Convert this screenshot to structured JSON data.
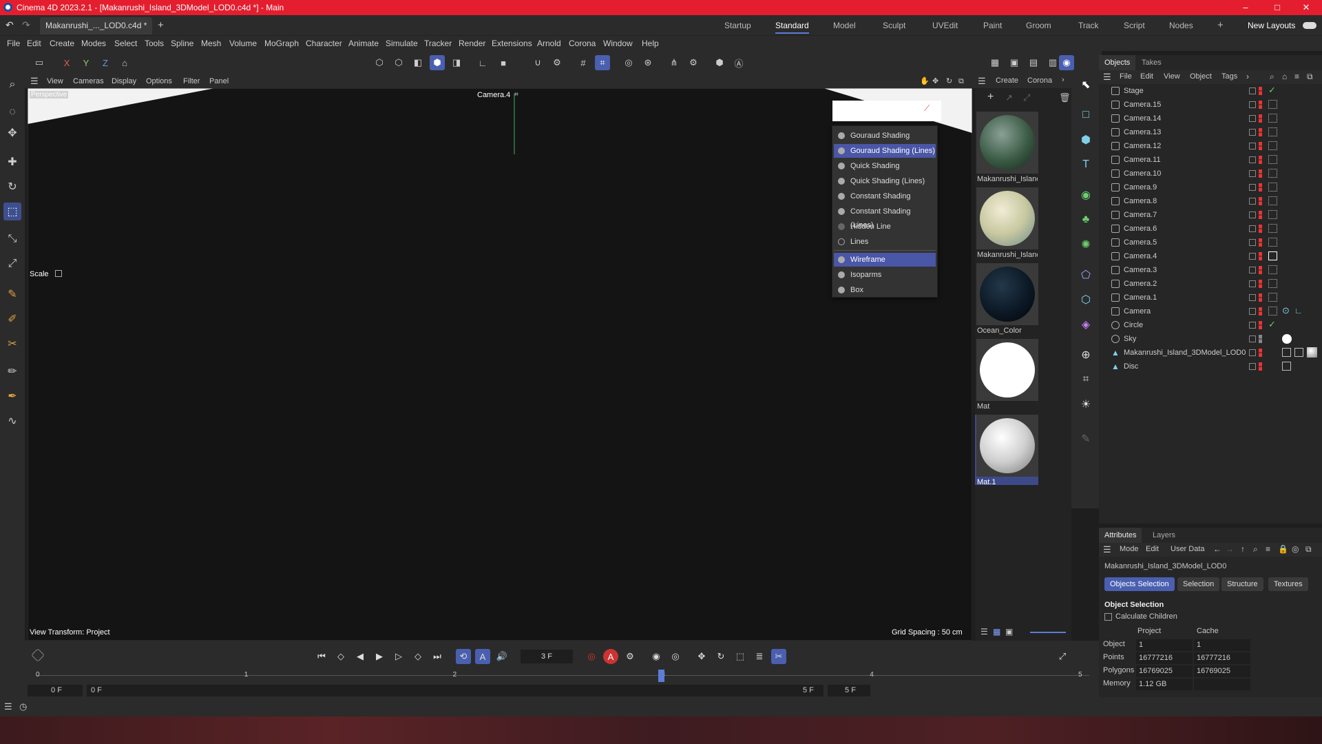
{
  "window": {
    "title": "Cinema 4D 2023.2.1 - [Makanrushi_Island_3DModel_LOD0.c4d *] - Main",
    "minimize": "–",
    "maximize": "□",
    "close": "✕"
  },
  "tabs": {
    "doc_tab": "Makanrushi_..._LOD0.c4d *",
    "add": "+",
    "layouts": [
      "Startup",
      "Standard",
      "Model",
      "Sculpt",
      "UVEdit",
      "Paint",
      "Groom",
      "Track",
      "Script",
      "Nodes"
    ],
    "active_layout": "Standard",
    "new_layouts": "New Layouts",
    "add_layout": "+"
  },
  "menu": [
    "File",
    "Edit",
    "Create",
    "Modes",
    "Select",
    "Tools",
    "Spline",
    "Mesh",
    "Volume",
    "MoGraph",
    "Character",
    "Animate",
    "Simulate",
    "Tracker",
    "Render",
    "Extensions",
    "Arnold",
    "Corona",
    "Window",
    "Help"
  ],
  "toolbar": {
    "axis_x": "X",
    "axis_y": "Y",
    "axis_z": "Z"
  },
  "viewport": {
    "menu": [
      "View",
      "Cameras",
      "Display",
      "Options",
      "Filter",
      "Panel"
    ],
    "label": "Perspective",
    "camera": "Camera.4",
    "tool_label": "Scale",
    "view_transform": "View Transform: Project",
    "grid_spacing": "Grid Spacing : 50 cm"
  },
  "display_menu": {
    "items": [
      "Gouraud Shading",
      "Gouraud Shading (Lines)",
      "Quick Shading",
      "Quick Shading (Lines)",
      "Constant Shading",
      "Constant Shading (Lines)",
      "Hidden Line",
      "Lines",
      "Wireframe",
      "Isoparms",
      "Box"
    ],
    "selected": [
      "Gouraud Shading (Lines)",
      "Wireframe"
    ]
  },
  "materials": {
    "menu": [
      "Create",
      "Corona"
    ],
    "items": [
      "Makanrushi_Islanc",
      "Makanrushi_Islanc",
      "Ocean_Color",
      "Mat",
      "Mat.1"
    ],
    "selected": "Mat.1"
  },
  "objects": {
    "tabs": [
      "Objects",
      "Takes"
    ],
    "menu": [
      "File",
      "Edit",
      "View",
      "Object",
      "Tags"
    ],
    "items": [
      "Stage",
      "Camera.15",
      "Camera.14",
      "Camera.13",
      "Camera.12",
      "Camera.11",
      "Camera.10",
      "Camera.9",
      "Camera.8",
      "Camera.7",
      "Camera.6",
      "Camera.5",
      "Camera.4",
      "Camera.3",
      "Camera.2",
      "Camera.1",
      "Camera",
      "Circle",
      "Sky",
      "Makanrushi_Island_3DModel_LOD0",
      "Disc"
    ]
  },
  "attributes": {
    "tabs": [
      "Attributes",
      "Layers"
    ],
    "menu": [
      "Mode",
      "Edit",
      "User Data"
    ],
    "object_name": "Makanrushi_Island_3DModel_LOD0",
    "subtabs": [
      "Objects Selection",
      "Selection",
      "Structure",
      "Textures"
    ],
    "section": "Object Selection",
    "calc_children": "Calculate Children",
    "col_project": "Project",
    "col_cache": "Cache",
    "rows": [
      {
        "label": "Object",
        "project": "1",
        "cache": "1"
      },
      {
        "label": "Points",
        "project": "16777216",
        "cache": "16777216"
      },
      {
        "label": "Polygons",
        "project": "16769025",
        "cache": "16769025"
      },
      {
        "label": "Memory",
        "project": "1.12 GB",
        "cache": ""
      }
    ]
  },
  "timeline": {
    "frame_field": "3 F",
    "ticks": [
      "0",
      "1",
      "2",
      "3",
      "4",
      "5"
    ],
    "start_min": "0 F",
    "start": "0 F",
    "end": "5 F",
    "end_max": "5 F",
    "current_frame": 3
  },
  "colors": {
    "title_bar": "#e41e2e",
    "accent": "#4a5fb0",
    "object_icon": "#7fd0e8"
  }
}
